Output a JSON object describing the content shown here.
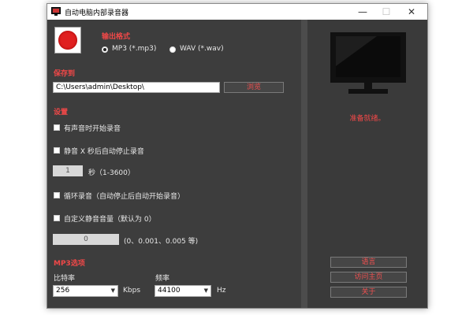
{
  "window": {
    "title": "自动电脑内部录音器"
  },
  "output_format": {
    "heading": "输出格式",
    "options": [
      {
        "label": "MP3 (*.mp3)",
        "selected": true
      },
      {
        "label": "WAV (*.wav)",
        "selected": false
      }
    ]
  },
  "save_to": {
    "heading": "保存到",
    "path": "C:\\Users\\admin\\Desktop\\",
    "browse_label": "浏览"
  },
  "settings": {
    "heading": "设置",
    "start_on_sound": {
      "label": "有声音时开始录音",
      "checked": false
    },
    "stop_after_silence": {
      "label": "静音 X 秒后自动停止录音",
      "checked": false
    },
    "seconds_value": "1",
    "seconds_label": "秒（1-3600）",
    "loop_record": {
      "label": "循环录音（自动停止后自动开始录音）",
      "checked": false
    },
    "custom_silence": {
      "label": "自定义静音音量（默认为 0）",
      "checked": false
    },
    "silence_value": "0",
    "silence_hint": "(0、0.001、0.005 等)"
  },
  "mp3_options": {
    "heading": "MP3选项",
    "bitrate_label": "比特率",
    "bitrate_value": "256",
    "bitrate_unit": "Kbps",
    "frequency_label": "频率",
    "frequency_value": "44100",
    "frequency_unit": "Hz"
  },
  "status_text": "准备就绪。",
  "side_buttons": {
    "language": "语言",
    "homepage": "访问主页",
    "about": "关于"
  },
  "colors": {
    "accent": "#f04848",
    "panel_bg": "#3d3d3d",
    "window_bg": "#464646"
  }
}
